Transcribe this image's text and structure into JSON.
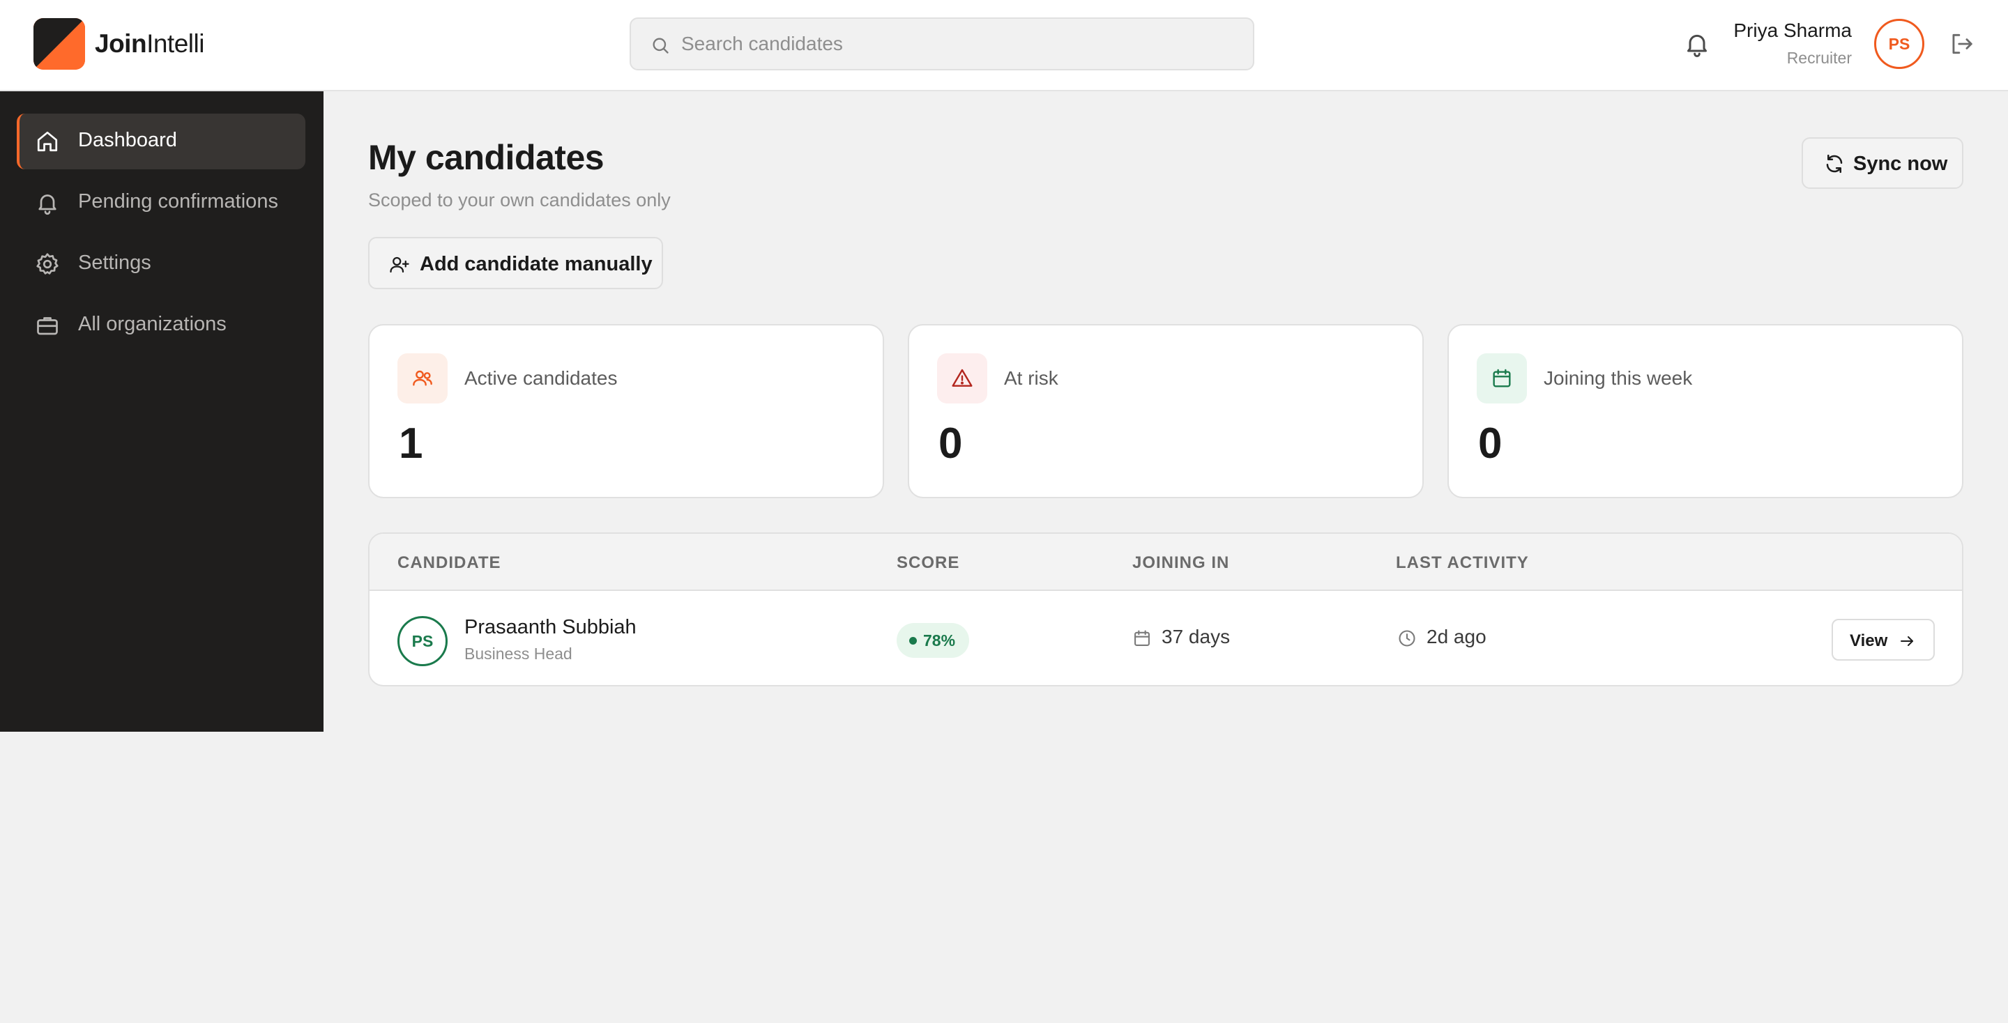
{
  "brand": {
    "bold": "Join",
    "regular": "Intelli"
  },
  "search": {
    "placeholder": "Search candidates",
    "value": ""
  },
  "user": {
    "name": "Priya Sharma",
    "role": "Recruiter",
    "initials": "PS"
  },
  "sidebar": {
    "items": [
      {
        "label": "Dashboard",
        "icon": "home-icon",
        "active": true
      },
      {
        "label": "Pending confirmations",
        "icon": "bell-icon",
        "active": false
      },
      {
        "label": "Settings",
        "icon": "gear-icon",
        "active": false
      },
      {
        "label": "All organizations",
        "icon": "briefcase-icon",
        "active": false
      }
    ]
  },
  "page": {
    "title": "My candidates",
    "subtitle": "Scoped to your own candidates only",
    "add_button": "Add candidate manually",
    "sync_button": "Sync now"
  },
  "stats": [
    {
      "label": "Active candidates",
      "value": "1",
      "icon": "users-icon",
      "color": "#f05a1e",
      "bg": "#fdefe8"
    },
    {
      "label": "At risk",
      "value": "0",
      "icon": "warning-icon",
      "color": "#b3261e",
      "bg": "#fdeeee"
    },
    {
      "label": "Joining this week",
      "value": "0",
      "icon": "calendar-icon",
      "color": "#1a7a4c",
      "bg": "#e8f6ee"
    }
  ],
  "table": {
    "headers": [
      "CANDIDATE",
      "SCORE",
      "JOINING IN",
      "LAST ACTIVITY"
    ],
    "rows": [
      {
        "initials": "PS",
        "name": "Prasaanth Subbiah",
        "title": "Business Head",
        "score": "78%",
        "joining_in": "37 days",
        "last_activity": "2d ago",
        "action": "View"
      }
    ]
  },
  "colors": {
    "accent": "#f05a1e",
    "sidebar_bg": "#1f1e1d",
    "success": "#1a7a4c"
  }
}
